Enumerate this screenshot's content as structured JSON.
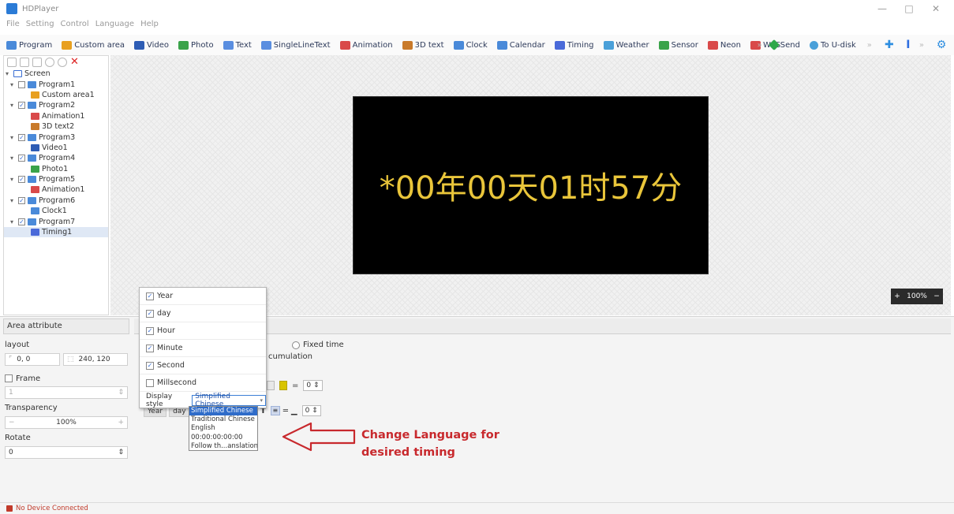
{
  "window": {
    "title": "HDPlayer",
    "controls": [
      "—",
      "□",
      "✕"
    ]
  },
  "menu": [
    "File",
    "Setting",
    "Control",
    "Language",
    "Help"
  ],
  "toolbar": {
    "items": [
      {
        "label": "Program",
        "color": "#4a8ad9"
      },
      {
        "label": "Custom area",
        "color": "#e8a020"
      },
      {
        "label": "Video",
        "color": "#2e5db5"
      },
      {
        "label": "Photo",
        "color": "#3aa34a"
      },
      {
        "label": "Text",
        "color": "#5a8ee0"
      },
      {
        "label": "SingleLineText",
        "color": "#5a8ee0"
      },
      {
        "label": "Animation",
        "color": "#d94a4a"
      },
      {
        "label": "3D text",
        "color": "#c97a2a"
      },
      {
        "label": "Clock",
        "color": "#4a8ad9"
      },
      {
        "label": "Calendar",
        "color": "#4a8ad9"
      },
      {
        "label": "Timing",
        "color": "#4a6ad9"
      },
      {
        "label": "Weather",
        "color": "#4aa0d9"
      },
      {
        "label": "Sensor",
        "color": "#3aa34a"
      },
      {
        "label": "Neon",
        "color": "#d94a4a"
      },
      {
        "label": "WPS",
        "color": "#d94a4a"
      }
    ],
    "send_label": "Send",
    "udisk_label": "To U-disk"
  },
  "tree": {
    "root": "Screen",
    "items": [
      {
        "label": "Program1",
        "level": 1,
        "expanded": true,
        "checked": false,
        "kind": "program"
      },
      {
        "label": "Custom area1",
        "level": 2,
        "kind": "custom"
      },
      {
        "label": "Program2",
        "level": 1,
        "expanded": true,
        "checked": true,
        "kind": "program"
      },
      {
        "label": "Animation1",
        "level": 2,
        "kind": "animation"
      },
      {
        "label": "3D text2",
        "level": 2,
        "kind": "3d"
      },
      {
        "label": "Program3",
        "level": 1,
        "expanded": true,
        "checked": true,
        "kind": "program"
      },
      {
        "label": "Video1",
        "level": 2,
        "kind": "video"
      },
      {
        "label": "Program4",
        "level": 1,
        "expanded": true,
        "checked": true,
        "kind": "program"
      },
      {
        "label": "Photo1",
        "level": 2,
        "kind": "photo"
      },
      {
        "label": "Program5",
        "level": 1,
        "expanded": true,
        "checked": true,
        "kind": "program"
      },
      {
        "label": "Animation1",
        "level": 2,
        "kind": "animation"
      },
      {
        "label": "Program6",
        "level": 1,
        "expanded": true,
        "checked": true,
        "kind": "program"
      },
      {
        "label": "Clock1",
        "level": 2,
        "kind": "clock"
      },
      {
        "label": "Program7",
        "level": 1,
        "expanded": true,
        "checked": true,
        "kind": "program"
      },
      {
        "label": "Timing1",
        "level": 2,
        "kind": "timing",
        "selected": true
      }
    ]
  },
  "preview": {
    "text": "*00年00天01时57分",
    "text_color": "#e9c53a",
    "zoom": "100%"
  },
  "area_attribute": {
    "header": "Area attribute",
    "layout_label": "layout",
    "position": "0, 0",
    "size": "240, 120",
    "frame_label": "Frame",
    "frame_value": "1",
    "transparency_label": "Transparency",
    "transparency_value": "100%",
    "rotate_label": "Rotate",
    "rotate_value": "0"
  },
  "timing": {
    "fixed_time_label": "Fixed time",
    "accumulation_label": "cumulation",
    "spin_value": "0",
    "spin2_value": "0",
    "chips": [
      "Year",
      "day"
    ]
  },
  "popup": {
    "items": [
      {
        "label": "Year",
        "checked": true
      },
      {
        "label": "day",
        "checked": true
      },
      {
        "label": "Hour",
        "checked": true
      },
      {
        "label": "Minute",
        "checked": true
      },
      {
        "label": "Second",
        "checked": true
      },
      {
        "label": "Millsecond",
        "checked": false
      }
    ],
    "display_style_label": "Display style",
    "display_style_value": "Simplified Chinese"
  },
  "dropdown_options": [
    "Simplified Chinese",
    "Traditional Chinese",
    "English",
    "00:00:00:00:00",
    "Follow th...anslation"
  ],
  "annotation": {
    "line1": "Change Language for",
    "line2": "desired timing",
    "color": "#c8292d"
  },
  "status": "No Device Connected"
}
